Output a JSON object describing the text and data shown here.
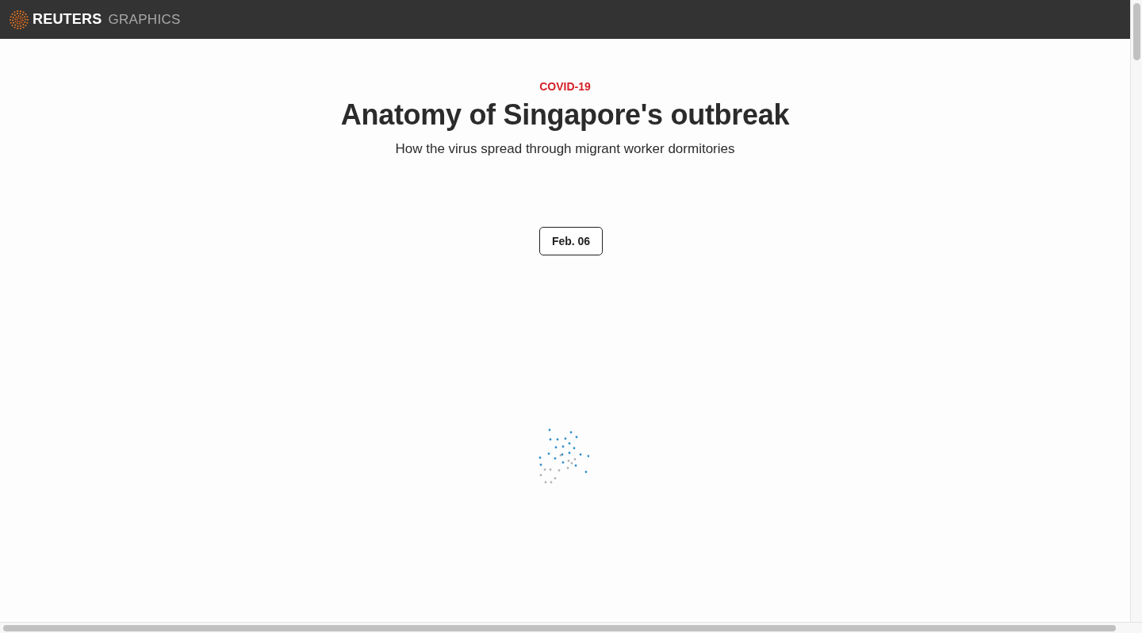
{
  "header": {
    "brand": "REUTERS",
    "section": "GRAPHICS"
  },
  "article": {
    "kicker": "COVID-19",
    "title": "Anatomy of Singapore's outbreak",
    "subtitle": "How the virus spread through migrant worker dormitories"
  },
  "graphic": {
    "date_label": "Feb. 06"
  }
}
